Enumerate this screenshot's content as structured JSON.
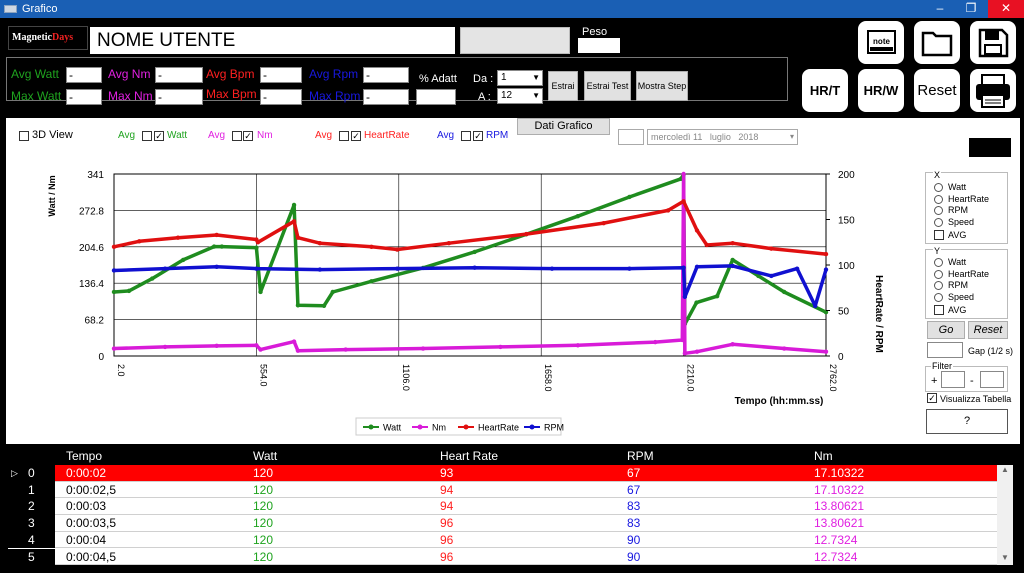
{
  "window": {
    "title": "Grafico",
    "minimize": "–",
    "restore": "❐",
    "close": "✕"
  },
  "header": {
    "logo": {
      "part1": "Magnetic",
      "part2": "Days"
    },
    "username": "NOME UTENTE",
    "peso_label": "Peso",
    "peso_value": ""
  },
  "stats": {
    "avg_watt_label": "Avg Watt",
    "avg_watt_value": "-",
    "max_watt_label": "Max Watt",
    "max_watt_value": "-",
    "avg_nm_label": "Avg Nm",
    "avg_nm_value": "-",
    "max_nm_label": "Max Nm",
    "max_nm_value": "-",
    "avg_bpm_label": "Avg Bpm",
    "avg_bpm_value": "-",
    "max_bpm_label": "Max Bpm",
    "max_bpm_value": "-",
    "avg_rpm_label": "Avg Rpm",
    "avg_rpm_value": "-",
    "max_rpm_label": "Max Rpm",
    "max_rpm_value": "-",
    "adatt_label": "% Adatt",
    "adatt_value": "",
    "da_label": "Da :",
    "da_value": "1",
    "a_label": "A :",
    "a_value": "12",
    "estrai_label": "Estrai",
    "estrai_test_label": "Estrai Test",
    "mostra_step_label": "Mostra Step"
  },
  "big_buttons": {
    "hrt": "HR/T",
    "hrw": "HR/W",
    "reset": "Reset",
    "note": "note"
  },
  "chart_controls": {
    "view3d_label": "3D View",
    "avg_label": "Avg",
    "watt_label": "Watt",
    "nm_label": "Nm",
    "heartrate_label": "HeartRate",
    "rpm_label": "RPM",
    "dati_grafico_label": "Dati Grafico",
    "date_weekday": "mercoledì 11",
    "date_month": "luglio",
    "date_year": "2018"
  },
  "right_panel": {
    "x_title": "X",
    "x_options": [
      "Watt",
      "HeartRate",
      "RPM",
      "Speed"
    ],
    "x_avg": "AVG",
    "y_title": "Y",
    "y_options": [
      "Watt",
      "HeartRate",
      "RPM",
      "Speed"
    ],
    "y_avg": "AVG",
    "go_label": "Go",
    "reset_label": "Reset",
    "gap_label": "Gap (1/2 s)",
    "filter_title": "Filter",
    "filter_plus": "+",
    "filter_minus": "-",
    "visualizza_label": "Visualizza Tabella",
    "help_label": "?"
  },
  "chart_data": {
    "type": "line",
    "xlabel": "Tempo (hh:mm.ss)",
    "ylabel": "Watt / Nm",
    "y2label": "HeartRate / RPM",
    "x_ticks": [
      "2.0",
      "554.0",
      "1106.0",
      "1658.0",
      "2210.0",
      "2762.0"
    ],
    "x_tick_values": [
      2,
      554,
      1106,
      1658,
      2210,
      2762
    ],
    "xlim": [
      2,
      2762
    ],
    "y_ticks": [
      "0",
      "68.2",
      "136.4",
      "204.6",
      "272.8",
      "341"
    ],
    "ylim": [
      0,
      341
    ],
    "y2_ticks": [
      "0",
      "50",
      "100",
      "150",
      "200"
    ],
    "y2lim": [
      0,
      200
    ],
    "grid": true,
    "legend_position": "bottom",
    "series": [
      {
        "name": "Watt",
        "axis": "left",
        "color": "#1f8c1f",
        "x": [
          2,
          60,
          150,
          270,
          390,
          420,
          554,
          570,
          700,
          715,
          816,
          850,
          1000,
          1200,
          1400,
          1600,
          1800,
          2000,
          2200,
          2210,
          2215,
          2260,
          2340,
          2400,
          2500,
          2600,
          2762
        ],
        "y": [
          120,
          122,
          145,
          180,
          205,
          205,
          203,
          120,
          283,
          95,
          94,
          120,
          140,
          165,
          195,
          228,
          262,
          298,
          332,
          340,
          60,
          100,
          112,
          180,
          150,
          120,
          82
        ]
      },
      {
        "name": "Nm",
        "axis": "left",
        "color": "#d81bd8",
        "x": [
          2,
          200,
          400,
          554,
          570,
          700,
          715,
          900,
          1200,
          1500,
          1800,
          2100,
          2205,
          2210,
          2215,
          2262,
          2400,
          2600,
          2762
        ],
        "y": [
          14,
          17,
          19,
          20,
          12,
          27,
          10,
          12,
          14,
          17,
          20,
          26,
          30,
          341,
          5,
          8,
          22,
          14,
          8
        ]
      },
      {
        "name": "HeartRate",
        "axis": "right",
        "color": "#e01010",
        "x": [
          2,
          100,
          250,
          400,
          554,
          560,
          700,
          715,
          800,
          1000,
          1100,
          1300,
          1600,
          1900,
          2150,
          2210,
          2262,
          2300,
          2400,
          2550,
          2762
        ],
        "y": [
          120,
          126,
          130,
          133,
          128,
          125,
          148,
          130,
          124,
          120,
          117,
          124,
          134,
          146,
          160,
          170,
          138,
          122,
          124,
          118,
          112
        ]
      },
      {
        "name": "RPM",
        "axis": "right",
        "color": "#1010d0",
        "x": [
          2,
          200,
          400,
          554,
          800,
          1100,
          1400,
          1700,
          2000,
          2210,
          2215,
          2262,
          2400,
          2550,
          2650,
          2720,
          2762
        ],
        "y": [
          94,
          96,
          98,
          96,
          95,
          96,
          97,
          96,
          96,
          97,
          65,
          98,
          99,
          88,
          96,
          55,
          95
        ]
      }
    ]
  },
  "table": {
    "headers": [
      "Tempo",
      "Watt",
      "Heart Rate",
      "RPM",
      "Nm"
    ],
    "rows": [
      [
        "0",
        "0:00:02",
        "120",
        "93",
        "67",
        "17.10322"
      ],
      [
        "1",
        "0:00:02,5",
        "120",
        "94",
        "67",
        "17.10322"
      ],
      [
        "2",
        "0:00:03",
        "120",
        "94",
        "83",
        "13.80621"
      ],
      [
        "3",
        "0:00:03,5",
        "120",
        "96",
        "83",
        "13.80621"
      ],
      [
        "4",
        "0:00:04",
        "120",
        "96",
        "90",
        "12.7324"
      ],
      [
        "5",
        "0:00:04,5",
        "120",
        "96",
        "90",
        "12.7324"
      ]
    ],
    "selected_row": 0
  }
}
